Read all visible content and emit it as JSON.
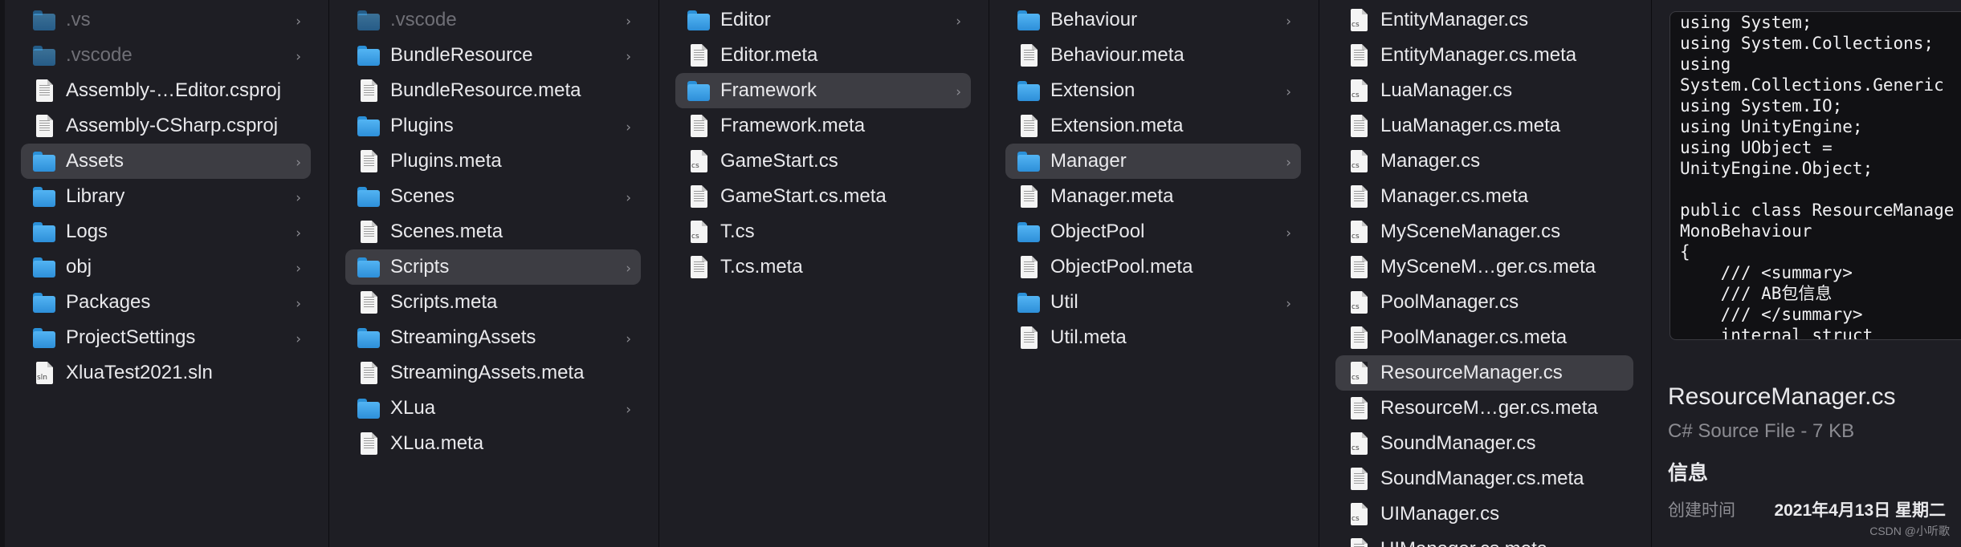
{
  "columns": [
    {
      "items": [
        {
          "label": ".vs",
          "type": "folder",
          "icon": "folder-icon",
          "dim": true,
          "chevron": true
        },
        {
          "label": ".vscode",
          "type": "folder",
          "icon": "folder-icon",
          "dim": true,
          "chevron": true
        },
        {
          "label": "Assembly-…Editor.csproj",
          "type": "file",
          "icon": "document-icon",
          "chevron": false
        },
        {
          "label": "Assembly-CSharp.csproj",
          "type": "file",
          "icon": "document-icon",
          "chevron": false
        },
        {
          "label": "Assets",
          "type": "folder",
          "icon": "folder-icon",
          "selected": true,
          "chevron": true
        },
        {
          "label": "Library",
          "type": "folder",
          "icon": "folder-icon",
          "chevron": true
        },
        {
          "label": "Logs",
          "type": "folder",
          "icon": "folder-icon",
          "chevron": true
        },
        {
          "label": "obj",
          "type": "folder",
          "icon": "folder-icon",
          "chevron": true
        },
        {
          "label": "Packages",
          "type": "folder",
          "icon": "folder-icon",
          "chevron": true
        },
        {
          "label": "ProjectSettings",
          "type": "folder",
          "icon": "folder-icon",
          "chevron": true
        },
        {
          "label": "XluaTest2021.sln",
          "type": "file",
          "icon": "sln-file-icon",
          "tag": "sln",
          "chevron": false
        }
      ]
    },
    {
      "items": [
        {
          "label": ".vscode",
          "type": "folder",
          "icon": "folder-icon",
          "dim": true,
          "chevron": true
        },
        {
          "label": "BundleResource",
          "type": "folder",
          "icon": "folder-icon",
          "chevron": true
        },
        {
          "label": "BundleResource.meta",
          "type": "file",
          "icon": "document-icon",
          "chevron": false
        },
        {
          "label": "Plugins",
          "type": "folder",
          "icon": "folder-icon",
          "chevron": true
        },
        {
          "label": "Plugins.meta",
          "type": "file",
          "icon": "document-icon",
          "chevron": false
        },
        {
          "label": "Scenes",
          "type": "folder",
          "icon": "folder-icon",
          "chevron": true
        },
        {
          "label": "Scenes.meta",
          "type": "file",
          "icon": "document-icon",
          "chevron": false
        },
        {
          "label": "Scripts",
          "type": "folder",
          "icon": "folder-icon",
          "selected": true,
          "chevron": true
        },
        {
          "label": "Scripts.meta",
          "type": "file",
          "icon": "document-icon",
          "chevron": false
        },
        {
          "label": "StreamingAssets",
          "type": "folder",
          "icon": "folder-icon",
          "chevron": true
        },
        {
          "label": "StreamingAssets.meta",
          "type": "file",
          "icon": "document-icon",
          "chevron": false
        },
        {
          "label": "XLua",
          "type": "folder",
          "icon": "folder-icon",
          "chevron": true
        },
        {
          "label": "XLua.meta",
          "type": "file",
          "icon": "document-icon",
          "chevron": false
        }
      ]
    },
    {
      "items": [
        {
          "label": "Editor",
          "type": "folder",
          "icon": "folder-icon",
          "chevron": true
        },
        {
          "label": "Editor.meta",
          "type": "file",
          "icon": "document-icon",
          "chevron": false
        },
        {
          "label": "Framework",
          "type": "folder",
          "icon": "folder-icon",
          "selected": true,
          "chevron": true
        },
        {
          "label": "Framework.meta",
          "type": "file",
          "icon": "document-icon",
          "chevron": false
        },
        {
          "label": "GameStart.cs",
          "type": "file",
          "icon": "cs-file-icon",
          "tag": "cs",
          "chevron": false
        },
        {
          "label": "GameStart.cs.meta",
          "type": "file",
          "icon": "document-icon",
          "chevron": false
        },
        {
          "label": "T.cs",
          "type": "file",
          "icon": "cs-file-icon",
          "tag": "cs",
          "chevron": false
        },
        {
          "label": "T.cs.meta",
          "type": "file",
          "icon": "document-icon",
          "chevron": false
        }
      ]
    },
    {
      "items": [
        {
          "label": "Behaviour",
          "type": "folder",
          "icon": "folder-icon",
          "chevron": true
        },
        {
          "label": "Behaviour.meta",
          "type": "file",
          "icon": "document-icon",
          "chevron": false
        },
        {
          "label": "Extension",
          "type": "folder",
          "icon": "folder-icon",
          "chevron": true
        },
        {
          "label": "Extension.meta",
          "type": "file",
          "icon": "document-icon",
          "chevron": false
        },
        {
          "label": "Manager",
          "type": "folder",
          "icon": "folder-icon",
          "selected": true,
          "chevron": true
        },
        {
          "label": "Manager.meta",
          "type": "file",
          "icon": "document-icon",
          "chevron": false
        },
        {
          "label": "ObjectPool",
          "type": "folder",
          "icon": "folder-icon",
          "chevron": true
        },
        {
          "label": "ObjectPool.meta",
          "type": "file",
          "icon": "document-icon",
          "chevron": false
        },
        {
          "label": "Util",
          "type": "folder",
          "icon": "folder-icon",
          "chevron": true
        },
        {
          "label": "Util.meta",
          "type": "file",
          "icon": "document-icon",
          "chevron": false
        }
      ]
    },
    {
      "items": [
        {
          "label": "EntityManager.cs",
          "type": "file",
          "icon": "cs-file-icon",
          "tag": "cs",
          "chevron": false
        },
        {
          "label": "EntityManager.cs.meta",
          "type": "file",
          "icon": "document-icon",
          "chevron": false
        },
        {
          "label": "LuaManager.cs",
          "type": "file",
          "icon": "cs-file-icon",
          "tag": "cs",
          "chevron": false
        },
        {
          "label": "LuaManager.cs.meta",
          "type": "file",
          "icon": "document-icon",
          "chevron": false
        },
        {
          "label": "Manager.cs",
          "type": "file",
          "icon": "cs-file-icon",
          "tag": "cs",
          "chevron": false
        },
        {
          "label": "Manager.cs.meta",
          "type": "file",
          "icon": "document-icon",
          "chevron": false
        },
        {
          "label": "MySceneManager.cs",
          "type": "file",
          "icon": "cs-file-icon",
          "tag": "cs",
          "chevron": false
        },
        {
          "label": "MySceneM…ger.cs.meta",
          "type": "file",
          "icon": "document-icon",
          "chevron": false
        },
        {
          "label": "PoolManager.cs",
          "type": "file",
          "icon": "cs-file-icon",
          "tag": "cs",
          "chevron": false
        },
        {
          "label": "PoolManager.cs.meta",
          "type": "file",
          "icon": "document-icon",
          "chevron": false
        },
        {
          "label": "ResourceManager.cs",
          "type": "file",
          "icon": "cs-file-icon",
          "tag": "cs",
          "selected": true,
          "chevron": false
        },
        {
          "label": "ResourceM…ger.cs.meta",
          "type": "file",
          "icon": "document-icon",
          "chevron": false
        },
        {
          "label": "SoundManager.cs",
          "type": "file",
          "icon": "cs-file-icon",
          "tag": "cs",
          "chevron": false
        },
        {
          "label": "SoundManager.cs.meta",
          "type": "file",
          "icon": "document-icon",
          "chevron": false
        },
        {
          "label": "UIManager.cs",
          "type": "file",
          "icon": "cs-file-icon",
          "tag": "cs",
          "chevron": false
        },
        {
          "label": "UIManager.cs.meta",
          "type": "file",
          "icon": "document-icon",
          "chevron": false
        }
      ]
    }
  ],
  "preview": {
    "code_lines": [
      "using System;",
      "using System.Collections;",
      "using",
      "System.Collections.Generic",
      "using System.IO;",
      "using UnityEngine;",
      "using UObject =",
      "UnityEngine.Object;",
      "",
      "public class ResourceManage",
      "MonoBehaviour",
      "{",
      "    /// <summary>",
      "    /// AB包信息",
      "    /// </summary>",
      "    internal struct"
    ],
    "file_name": "ResourceManager.cs",
    "file_kind": "C# Source File - 7 KB",
    "info_heading": "信息",
    "created_label": "创建时间",
    "created_value": "2021年4月13日 星期二"
  },
  "watermark": "CSDN @小听歌",
  "colors": {
    "background": "#1e1e24",
    "selection": "#3d3d43",
    "folder_blue": "#3fa3ec",
    "text": "#e9e9ec",
    "secondary_text": "#8c8c92"
  }
}
